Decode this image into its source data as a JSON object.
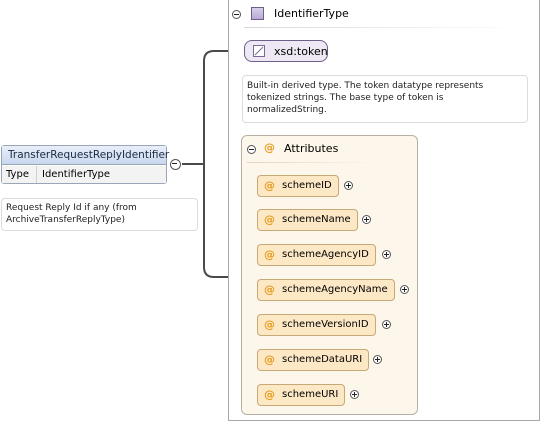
{
  "type_panel": {
    "title": "IdentifierType"
  },
  "element": {
    "name": "TransferRequestReplyIdentifier",
    "type_label": "Type",
    "type_value": "IdentifierType",
    "doc": "Request Reply Id if any (from ArchiveTransferReplyType)"
  },
  "base_type": {
    "name": "xsd:token",
    "doc": "Built-in derived type. The token datatype represents tokenized strings. The base type of token is normalizedString."
  },
  "attributes": {
    "title": "Attributes",
    "items": [
      {
        "name": "schemeID"
      },
      {
        "name": "schemeName"
      },
      {
        "name": "schemeAgencyID"
      },
      {
        "name": "schemeAgencyName"
      },
      {
        "name": "schemeVersionID"
      },
      {
        "name": "schemeDataURI"
      },
      {
        "name": "schemeURI"
      }
    ]
  },
  "colors": {
    "connector": "#4a4a4a",
    "attribute_fill": "#fde8c6",
    "attribute_panel": "#fdf6ea",
    "element_header": "#c8d8f0",
    "token_fill": "#ede8f4"
  }
}
